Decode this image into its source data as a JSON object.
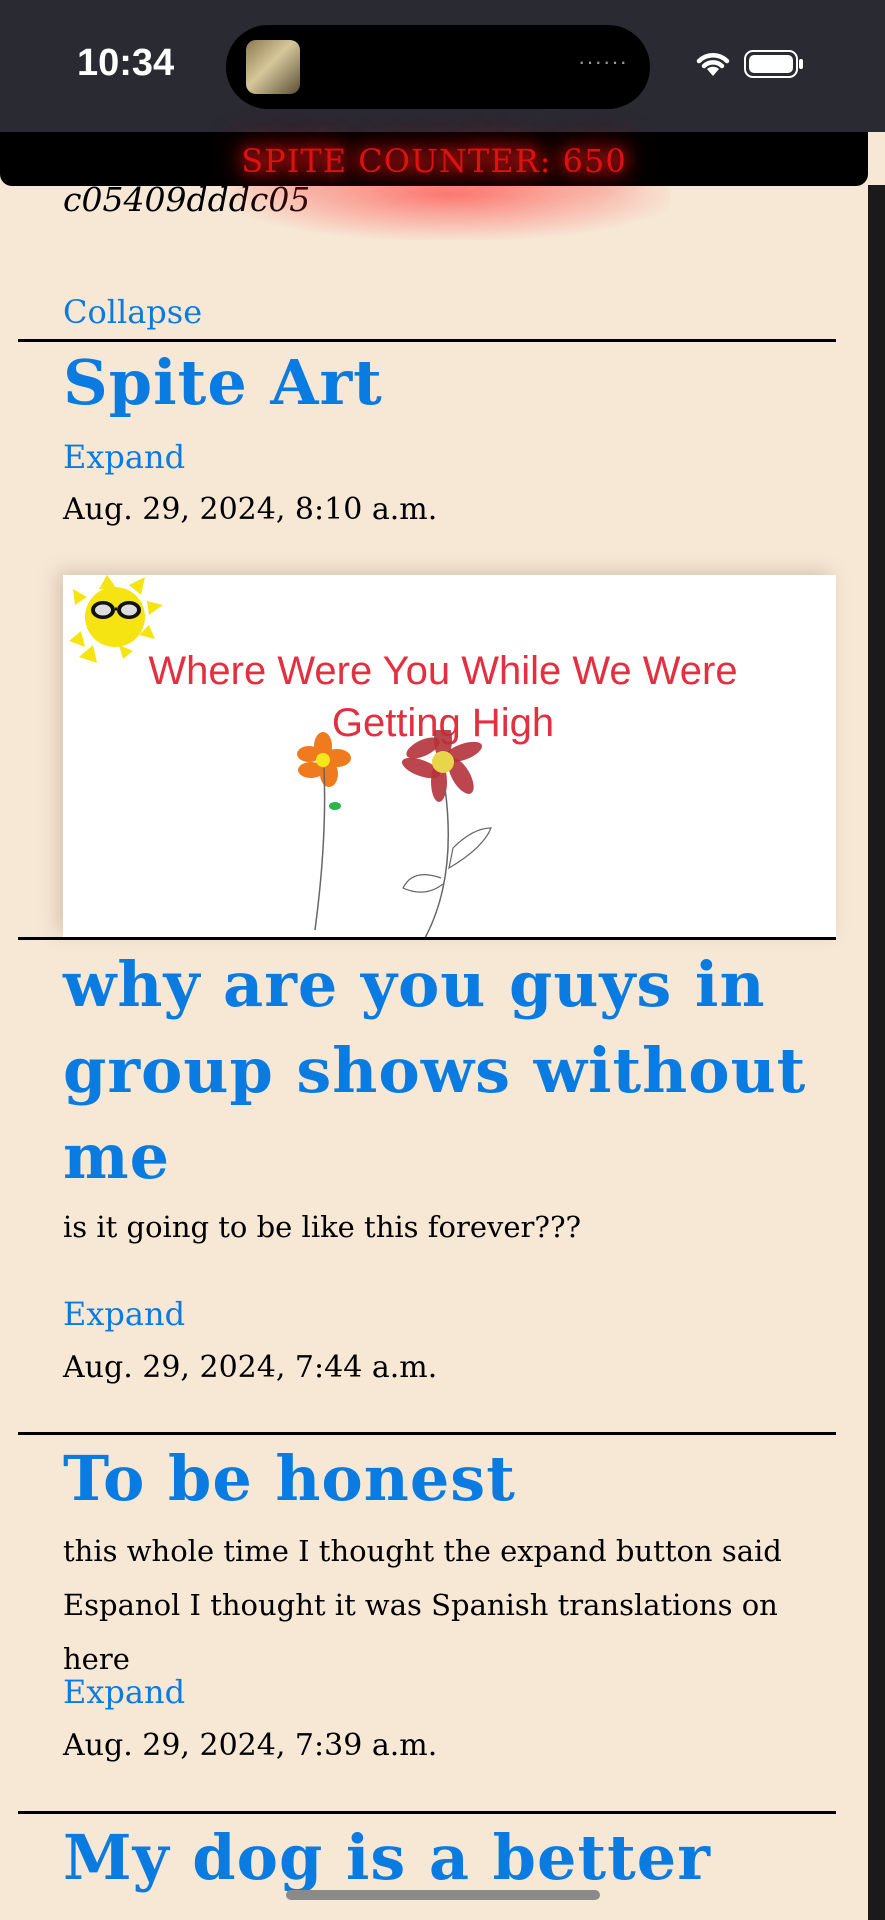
{
  "status_bar": {
    "time": "10:34",
    "island_dots": "······"
  },
  "spite_counter": {
    "label": "SPITE COUNTER: 650"
  },
  "top_post": {
    "hash": "c05409dddc05",
    "collapse_label": "Collapse"
  },
  "posts": [
    {
      "title": "Spite Art",
      "expand_label": "Expand",
      "date": "Aug. 29, 2024, 8:10 a.m.",
      "image_caption": "Where Were You While We Were Getting High"
    },
    {
      "title": "why are you guys in group shows without me",
      "body": "is it going to be like this forever???",
      "expand_label": "Expand",
      "date": "Aug. 29, 2024, 7:44 a.m."
    },
    {
      "title": "To be honest",
      "body": "this whole time I thought the expand button said Espanol I thought it was Spanish translations on here",
      "expand_label": "Expand",
      "date": "Aug. 29, 2024, 7:39 a.m."
    },
    {
      "title": "My dog is a better"
    }
  ],
  "colors": {
    "background": "#f7e8d6",
    "link": "#0a7be0",
    "counter_red": "#e01010",
    "caption_red": "#e33040"
  }
}
